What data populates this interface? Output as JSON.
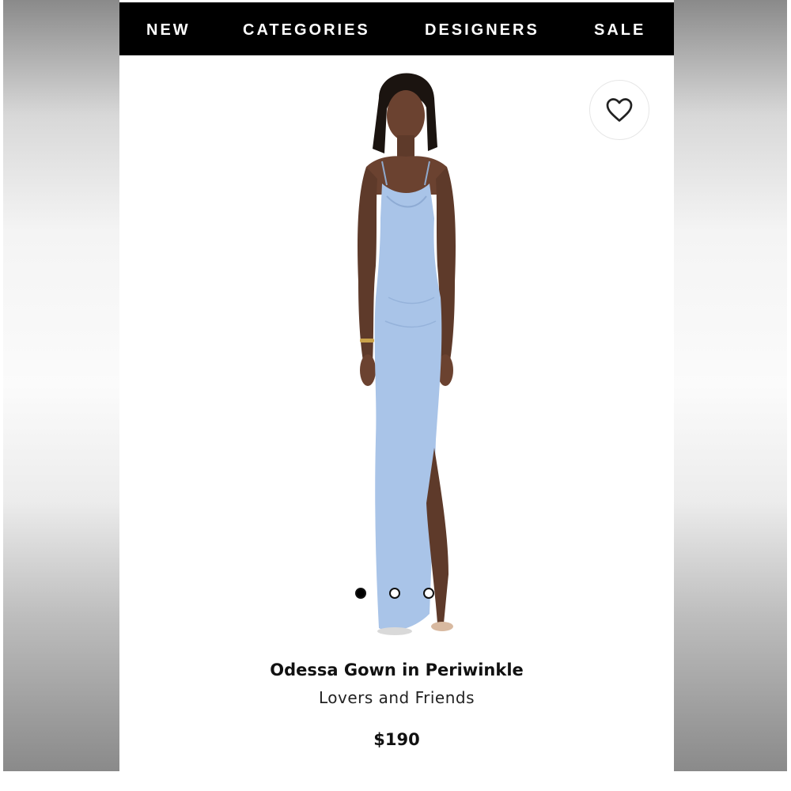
{
  "nav": {
    "items": [
      {
        "label": "NEW"
      },
      {
        "label": "CATEGORIES"
      },
      {
        "label": "DESIGNERS"
      },
      {
        "label": "SALE"
      }
    ]
  },
  "product": {
    "image_icon": "model-in-gown-image",
    "dress_color": "#a9c4e8",
    "title": "Odessa Gown in Periwinkle",
    "brand": "Lovers and Friends",
    "price": "$190",
    "carousel": {
      "count": 3,
      "active_index": 0
    }
  },
  "favorite": {
    "icon": "heart-outline-icon"
  },
  "colors": {
    "nav_background": "#000000",
    "nav_text": "#ffffff"
  }
}
